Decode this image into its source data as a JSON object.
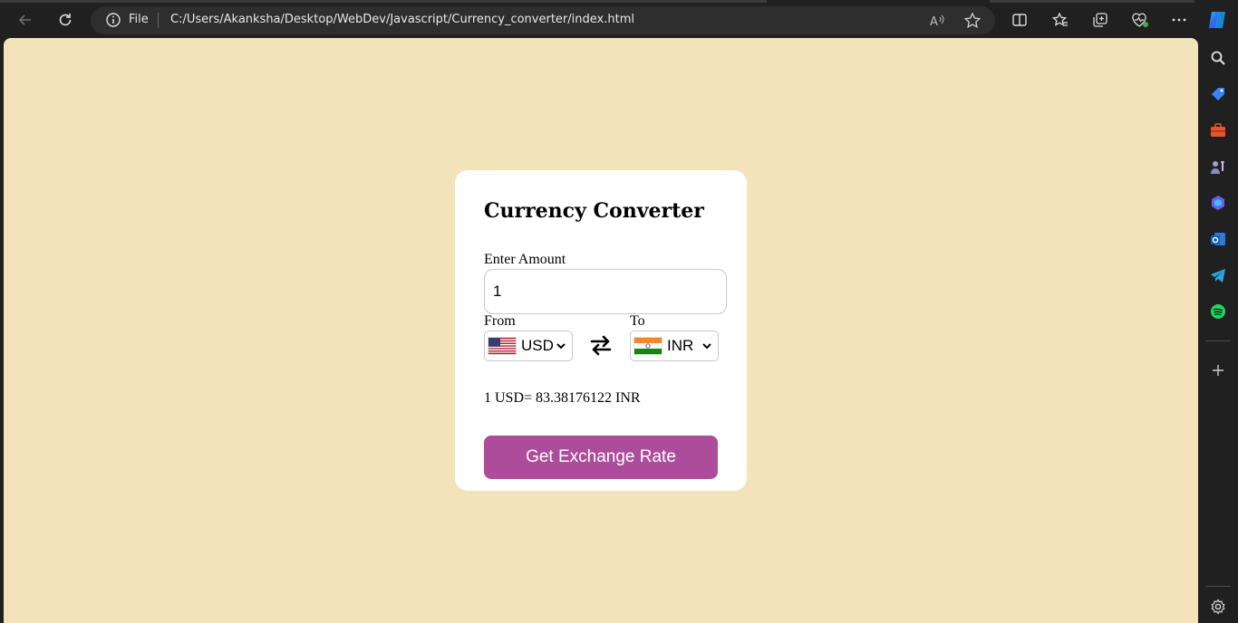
{
  "browser": {
    "addr_scheme": "File",
    "url": "C:/Users/Akanksha/Desktop/WebDev/Javascript/Currency_converter/index.html",
    "icons": [
      "back-icon",
      "refresh-icon",
      "info-icon",
      "read-aloud-icon",
      "favorite-star-icon",
      "split-screen-icon",
      "favorites-icon",
      "collections-icon",
      "browser-essentials-icon",
      "more-icon",
      "copilot-icon"
    ]
  },
  "rail": {
    "icons": [
      "search-icon",
      "shopping-tag-icon",
      "tools-icon",
      "games-icon",
      "m365-icon",
      "outlook-icon",
      "telegram-icon",
      "spotify-icon",
      "add-icon",
      "settings-icon"
    ]
  },
  "app": {
    "title": "Currency Converter",
    "amount_label": "Enter Amount",
    "amount_value": "1",
    "from_label": "From",
    "to_label": "To",
    "from_currency": "USD",
    "to_currency": "INR",
    "result": "1 USD= 83.38176122 INR",
    "button": "Get Exchange Rate"
  },
  "colors": {
    "page_bg": "#f2e3bb",
    "card_bg": "#ffffff",
    "button_bg": "#ad4c9b",
    "button_text": "#ffffff"
  }
}
